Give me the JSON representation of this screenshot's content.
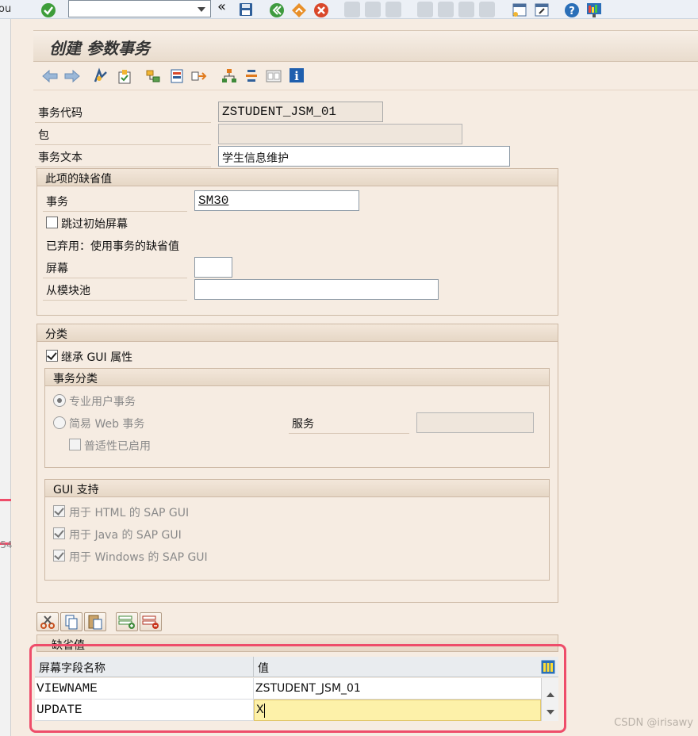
{
  "window": {
    "title": "创建 参数事务"
  },
  "system_toolbar": {
    "icons": [
      "enter-icon",
      "back-icon",
      "exit-icon",
      "cancel-icon",
      "save-icon",
      "print-icon",
      "find-icon",
      "find-next-icon",
      "first-page-icon",
      "prev-page-icon",
      "next-page-icon",
      "last-page-icon",
      "new-session-icon",
      "shortcut-icon",
      "help-icon",
      "layout-icon"
    ],
    "command_field": {
      "value": ""
    },
    "left_sliver": {
      "top_text": "ou",
      "side_text": "-54"
    }
  },
  "app_toolbar": {
    "icons": [
      "arrow-left-icon",
      "arrow-right-icon",
      "display-change-icon",
      "activate-icon",
      "object-list-icon",
      "where-used-icon",
      "navigate-icon",
      "hierarchy-icon",
      "menu-list-icon",
      "documentation-icon",
      "info-icon"
    ]
  },
  "header": {
    "tcode_label": "事务代码",
    "tcode_value": "ZSTUDENT_JSM_01",
    "package_label": "包",
    "package_value": "",
    "text_label": "事务文本",
    "text_value": "学生信息维护"
  },
  "defaults_group": {
    "title": "此项的缺省值",
    "transaction_label": "事务",
    "transaction_value": "SM30",
    "skip_initial_label": "跳过初始屏幕",
    "skip_initial_checked": false,
    "obsolete_note": "已弃用：使用事务的缺省值",
    "screen_label": "屏幕",
    "screen_value": "",
    "module_pool_label": "从模块池",
    "module_pool_value": ""
  },
  "classification_group": {
    "title": "分类",
    "inherit_gui_label": "继承 GUI 属性",
    "inherit_gui_checked": true,
    "tx_class": {
      "title": "事务分类",
      "professional_label": "专业用户事务",
      "professional_selected": true,
      "easy_web_label": "简易 Web 事务",
      "easy_web_selected": false,
      "service_label": "服务",
      "service_value": "",
      "pervasive_label": "普适性已启用",
      "pervasive_checked": false
    },
    "gui_support": {
      "title": "GUI 支持",
      "html_label": "用于 HTML 的 SAP GUI",
      "java_label": "用于 Java 的 SAP GUI",
      "windows_label": "用于 Windows 的 SAP GUI"
    }
  },
  "table_toolbar": {
    "icons": [
      "cut-icon",
      "copy-icon",
      "paste-icon",
      "insert-row-icon",
      "delete-row-icon"
    ]
  },
  "default_values_table": {
    "title": "缺省值",
    "columns": [
      "屏幕字段名称",
      "值"
    ],
    "rows": [
      {
        "field": "VIEWNAME",
        "value": "ZSTUDENT_JSM_01"
      },
      {
        "field": "UPDATE",
        "value": "X"
      }
    ]
  },
  "watermark": "CSDN @irisawy",
  "colors": {
    "highlight_border": "#ee4d6a",
    "edit_cell": "#fdf1a9",
    "accent_blue": "#2a6fb8"
  }
}
